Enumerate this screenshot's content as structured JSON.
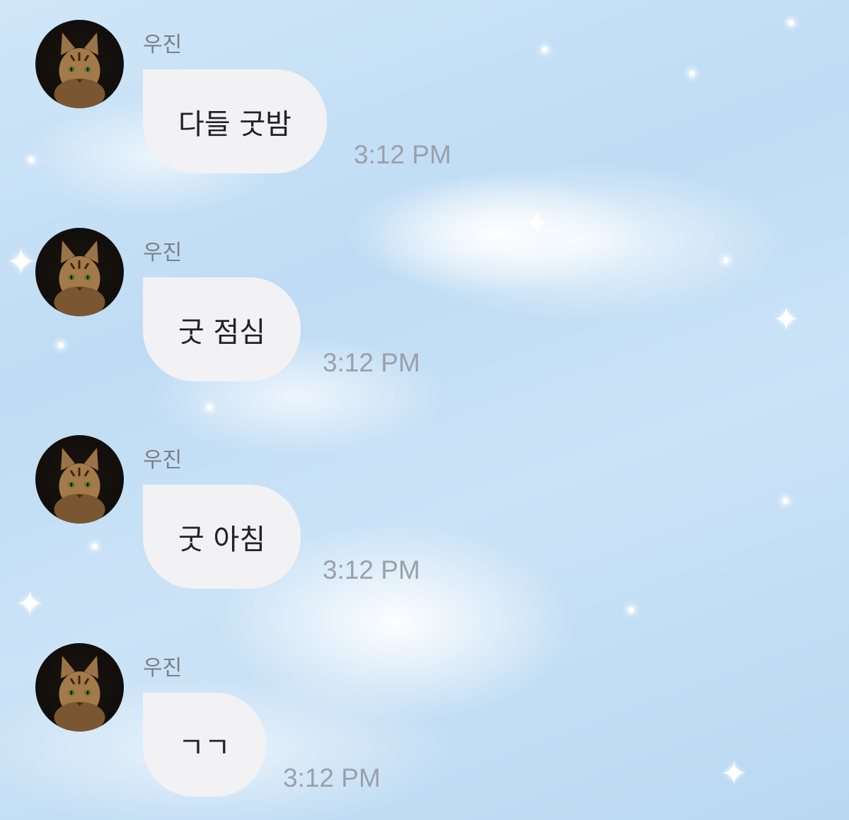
{
  "chat": {
    "messages": [
      {
        "sender": "우진",
        "text": "다들 굿밤",
        "time": "3:12 PM"
      },
      {
        "sender": "우진",
        "text": "굿 점심",
        "time": "3:12 PM"
      },
      {
        "sender": "우진",
        "text": "굿 아침",
        "time": "3:12 PM"
      },
      {
        "sender": "우진",
        "text": "ㄱㄱ",
        "time": "3:12 PM"
      }
    ]
  },
  "icons": {
    "avatar": "cat-avatar-icon",
    "sparkle": "sparkle-icon"
  },
  "colors": {
    "background": "#c4dff5",
    "bubble": "#f2f2f5",
    "sender_text": "#7b7f86",
    "message_text": "#222222",
    "timestamp": "#9aa0ab"
  }
}
